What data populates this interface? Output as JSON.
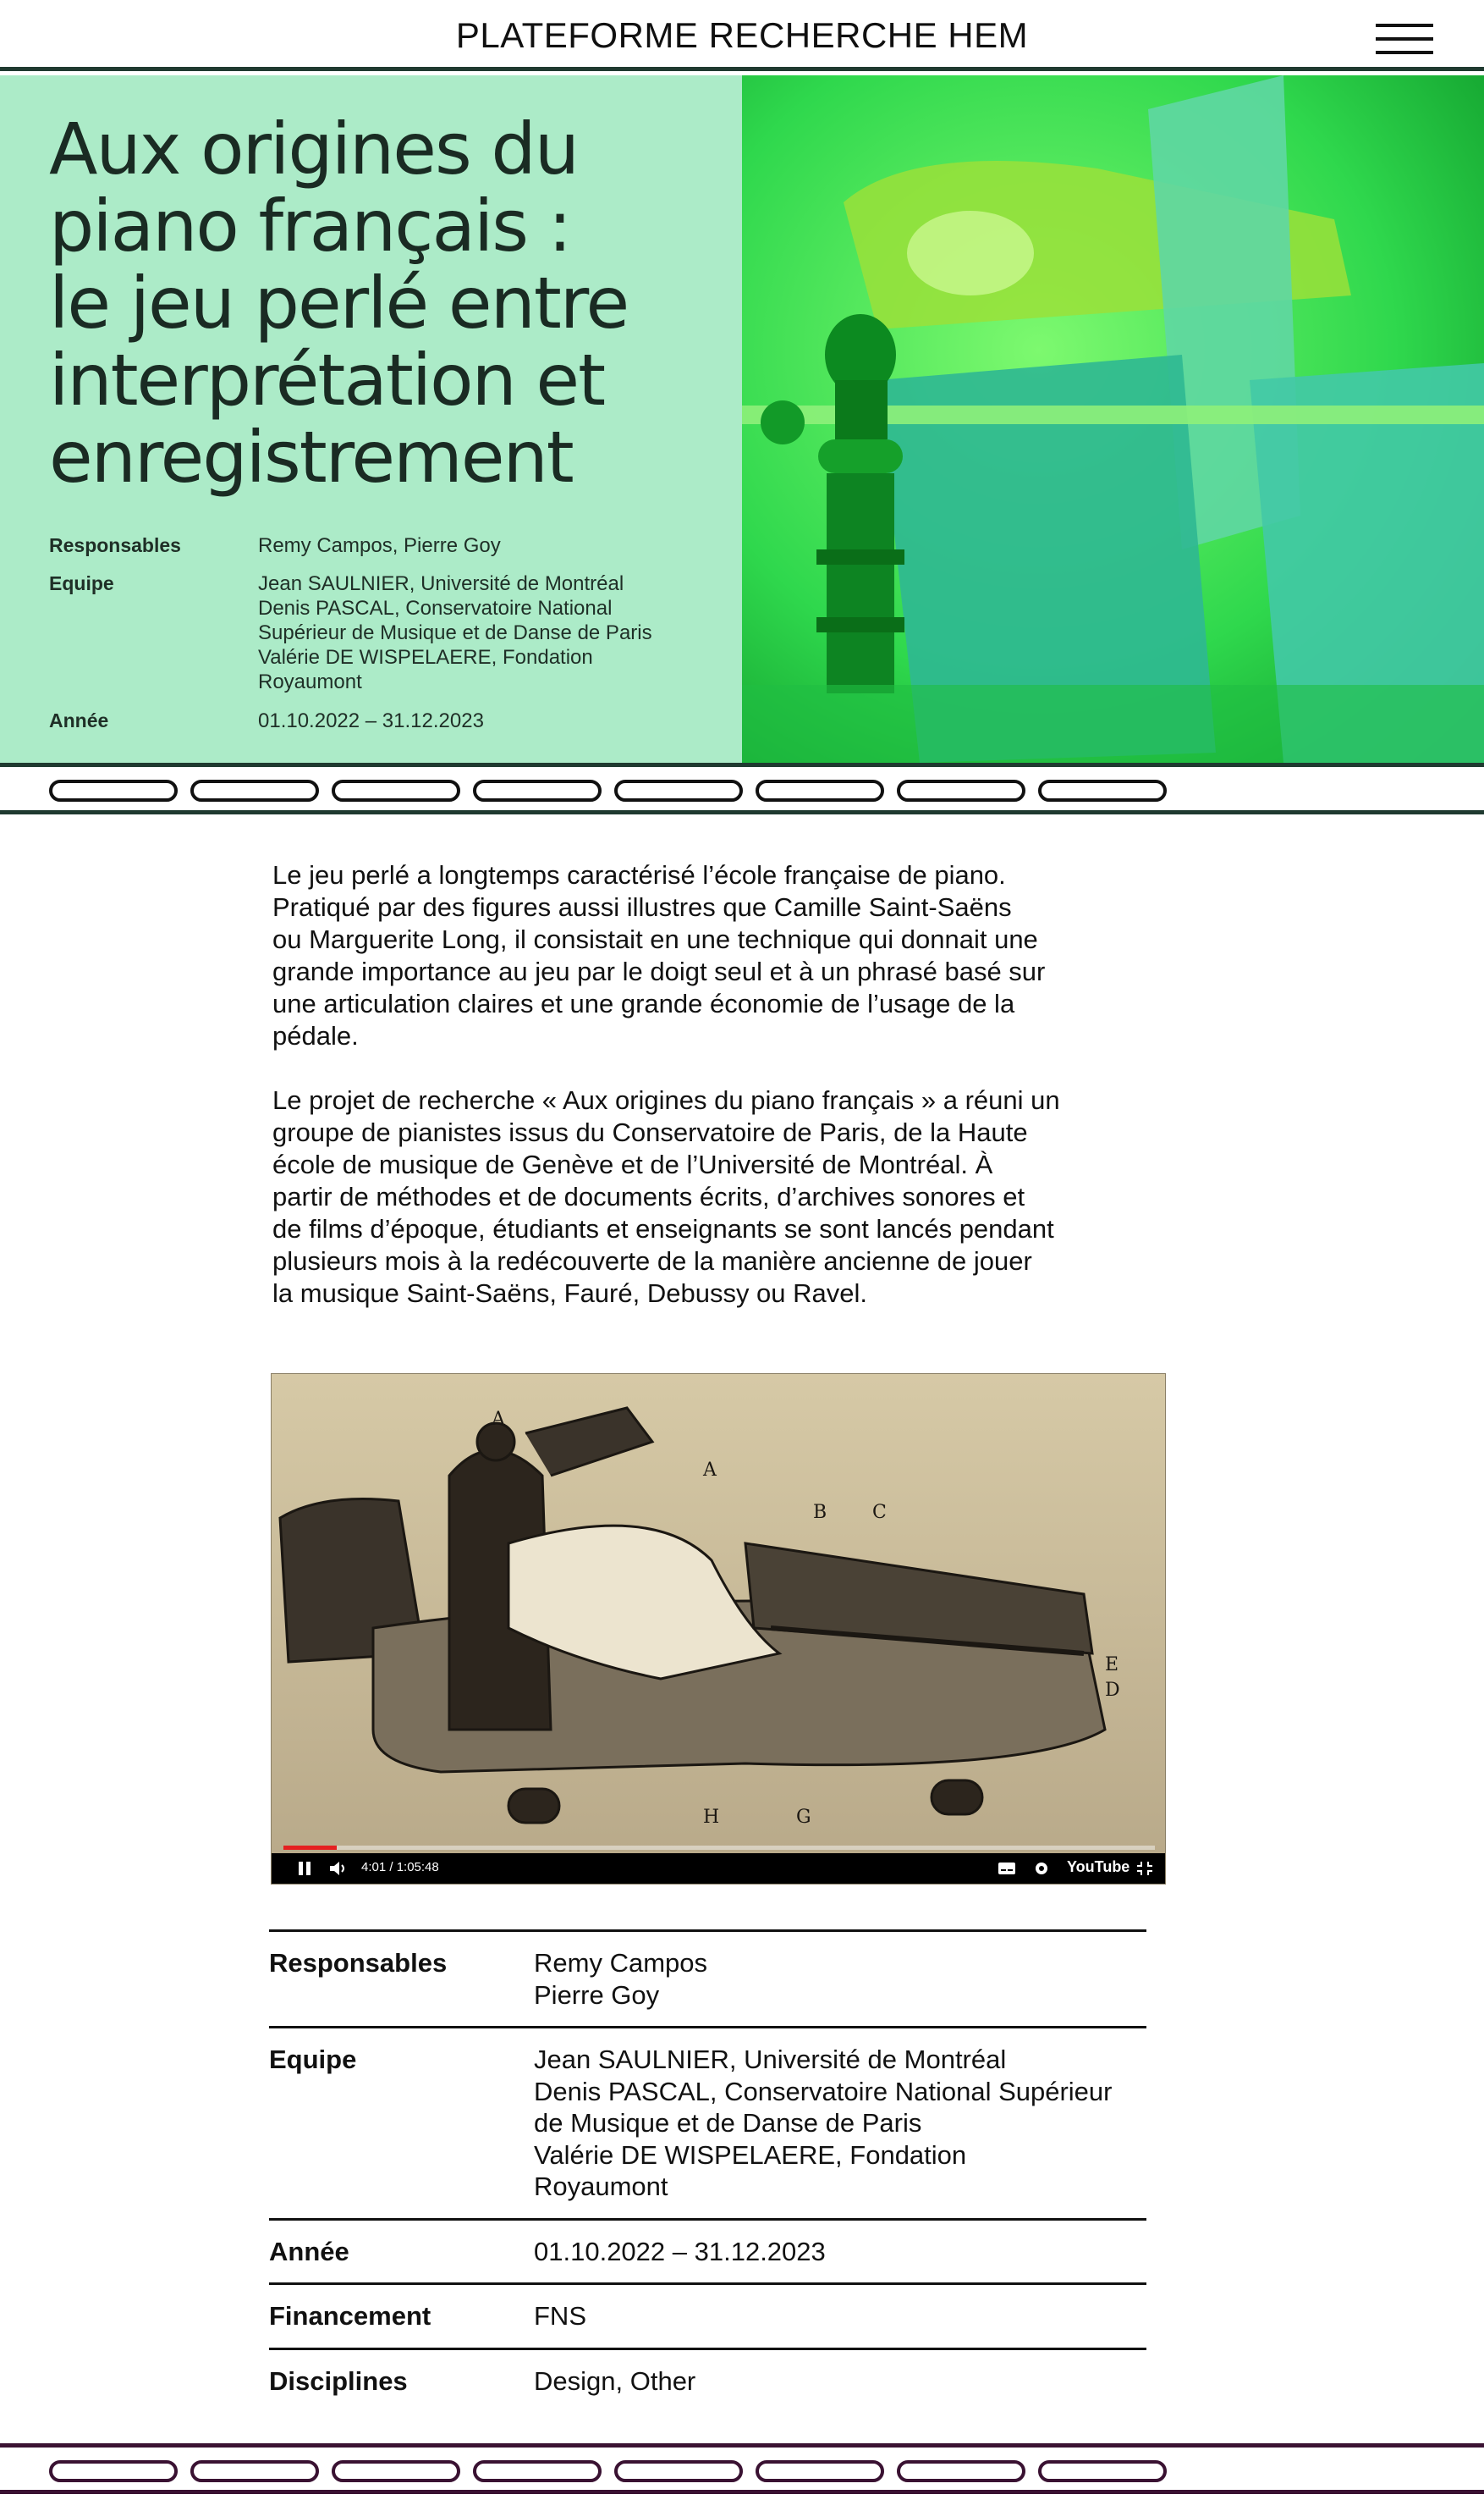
{
  "header": {
    "site_title": "PLATEFORME RECHERCHE HEM",
    "menu_icon": "hamburger-menu-icon"
  },
  "hero": {
    "title": "Aux origines du piano français : le jeu perlé entre interprétation et enregistrement",
    "title_lines": [
      "Aux origines du",
      "piano français :",
      "le jeu perlé entre",
      "interprétation et",
      "enregistrement"
    ],
    "background_color": "#acebc8",
    "image_tint": "#2fd84d",
    "meta": {
      "responsables_label": "Responsables",
      "responsables_value": "Remy Campos, Pierre Goy",
      "equipe_label": "Equipe",
      "equipe_lines": [
        "Jean SAULNIER, Université de Montréal",
        "Denis PASCAL, Conservatoire National",
        "Supérieur de Musique et de Danse de Paris",
        "Valérie DE WISPELAERE, Fondation",
        "Royaumont"
      ],
      "annee_label": "Année",
      "annee_value": "01.10.2022 – 31.12.2023"
    }
  },
  "tabs_top": {
    "count": 8,
    "line_color": "#1f3a30"
  },
  "tabs_bottom": {
    "count": 8,
    "line_color": "#3a1232"
  },
  "intro": {
    "paragraphs": [
      "Le jeu perlé a longtemps caractérisé l’école française de piano.\nPratiqué par des figures aussi illustres que Camille Saint-Saëns\nou Marguerite Long, il consistait en une technique qui donnait une\ngrande importance au  jeu par le doigt seul et à un phrasé basé sur\nune articulation claires et une grande économie de l’usage de la\npédale.",
      "Le projet de recherche « Aux origines du piano français » a réuni un\ngroupe de pianistes issus du Conservatoire de Paris, de la Haute\nécole de musique de Genève et de l’Université de Montréal. À\npartir de méthodes et de documents écrits, d’archives sonores et\nde films d’époque, étudiants et enseignants se sont lancés pendant\nplusieurs mois à la redécouverte de la manière ancienne de jouer\nla musique Saint-Saëns, Fauré, Debussy ou Ravel."
    ]
  },
  "video": {
    "time_display": "4:01 / 1:05:48",
    "progress_fraction": 0.061,
    "brand": "YouTube",
    "figure_labels": [
      "A",
      "A",
      "B",
      "C",
      "D",
      "E",
      "H",
      "G"
    ]
  },
  "details": [
    {
      "label": "Responsables",
      "lines": [
        "Remy Campos",
        "Pierre Goy"
      ]
    },
    {
      "label": "Equipe",
      "lines": [
        "Jean SAULNIER, Université de Montréal",
        "Denis PASCAL, Conservatoire National Supérieur",
        "de Musique et de Danse de Paris",
        "Valérie DE WISPELAERE, Fondation",
        "Royaumont"
      ]
    },
    {
      "label": "Année",
      "lines": [
        "01.10.2022 – 31.12.2023"
      ]
    },
    {
      "label": "Financement",
      "lines": [
        "FNS"
      ]
    },
    {
      "label": "Disciplines",
      "lines": [
        "Design, Other"
      ]
    }
  ]
}
